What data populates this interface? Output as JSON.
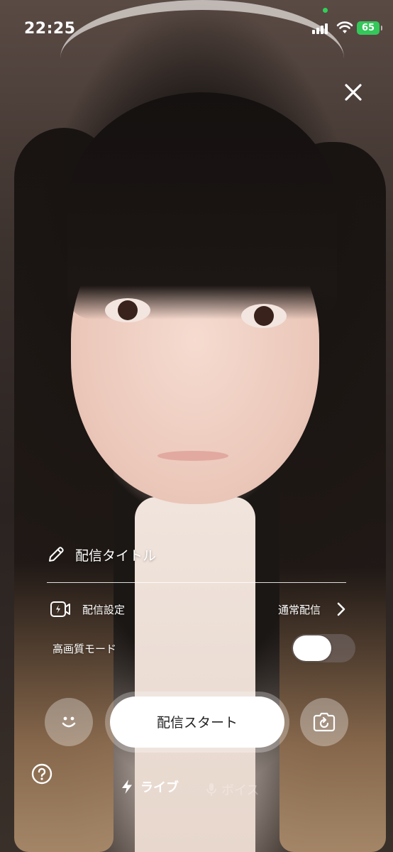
{
  "status_bar": {
    "time": "22:25",
    "battery": "65"
  },
  "header": {
    "close_icon": "close-icon"
  },
  "stream_setup": {
    "title_placeholder": "配信タイトル",
    "settings_label": "配信設定",
    "settings_value": "通常配信",
    "hq_mode_label": "高画質モード",
    "hq_mode_on": false
  },
  "controls": {
    "start_label": "配信スタート"
  },
  "modes": {
    "live_label": "ライブ",
    "voice_label": "ボイス",
    "selected": "live"
  },
  "colors": {
    "battery": "#34c759",
    "camera_indicator": "#30d158"
  }
}
